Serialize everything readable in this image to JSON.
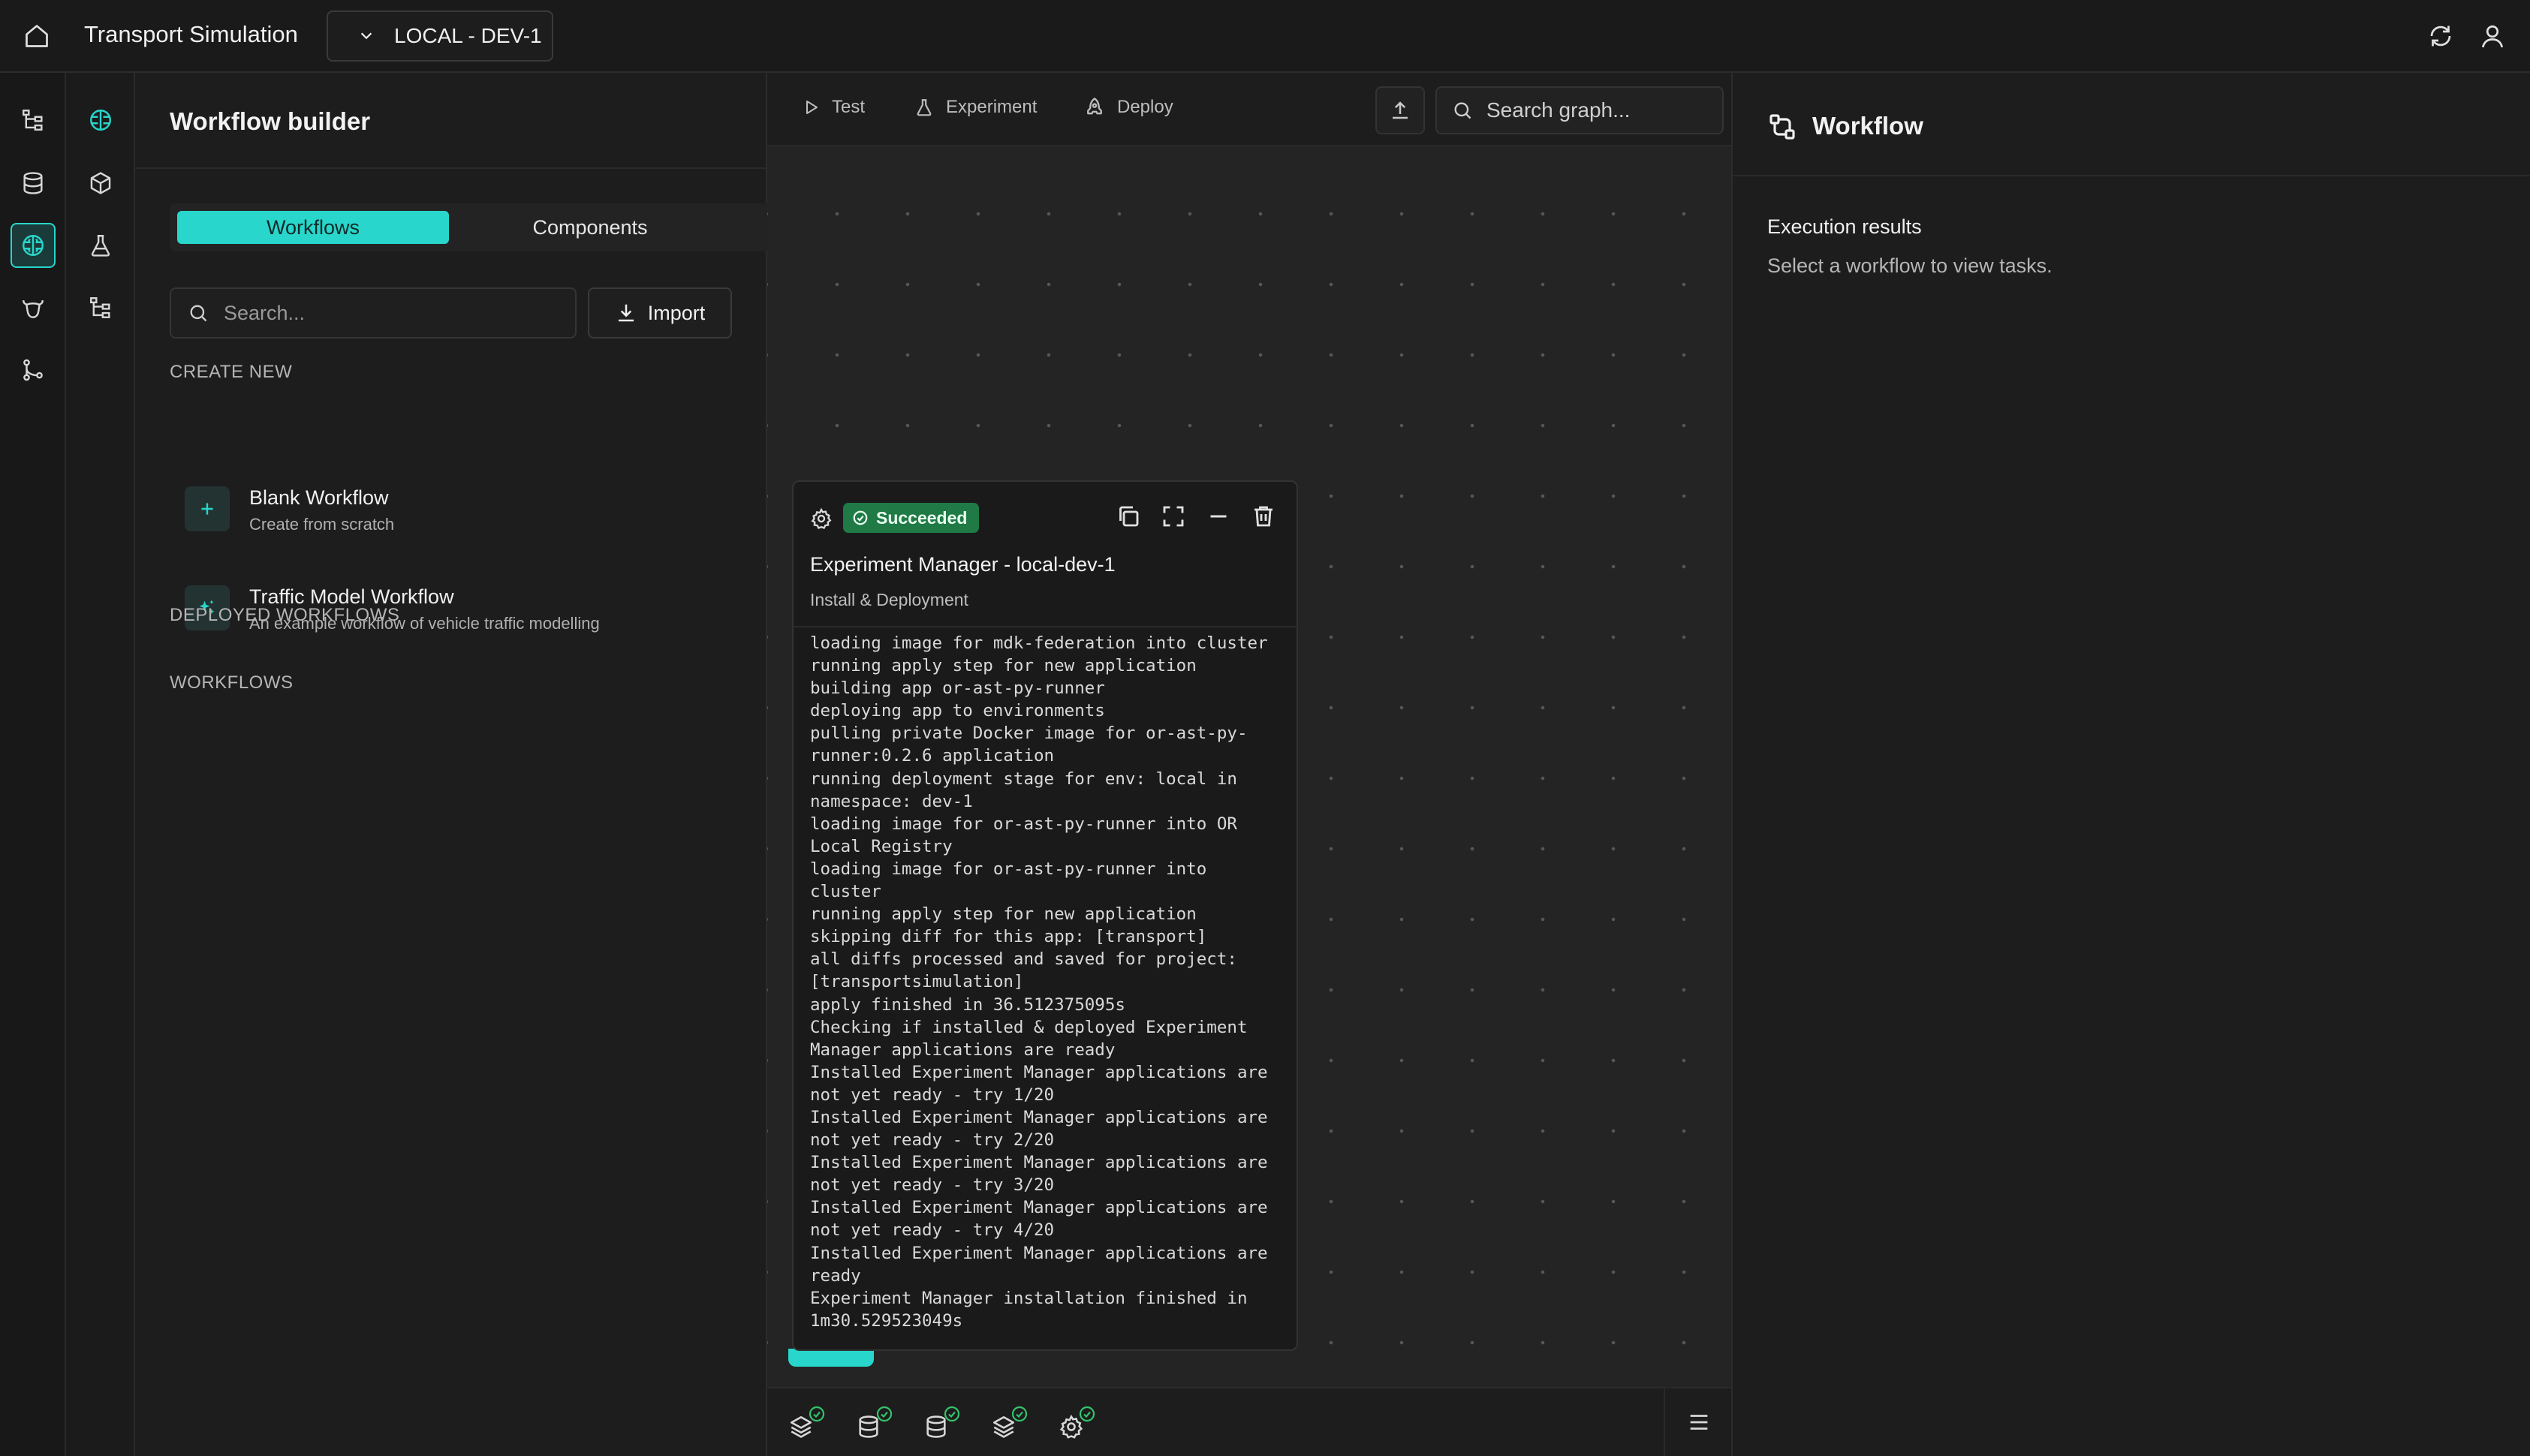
{
  "app": {
    "title": "Transport Simulation",
    "environment": "LOCAL - DEV-1"
  },
  "colors": {
    "accent": "#28d6cb",
    "success": "#1f7a45",
    "success_check": "#33c46b"
  },
  "left_panel": {
    "title": "Workflow builder",
    "tabs": [
      {
        "label": "Workflows",
        "active": true
      },
      {
        "label": "Components",
        "active": false
      }
    ],
    "search_placeholder": "Search...",
    "import_label": "Import",
    "create_new_label": "CREATE NEW",
    "create_items": [
      {
        "title": "Blank Workflow",
        "subtitle": "Create from scratch",
        "icon": "plus-icon"
      },
      {
        "title": "Traffic Model Workflow",
        "subtitle": "An example workflow of vehicle traffic modelling",
        "icon": "sparkle-icon"
      }
    ],
    "deployed_label": "DEPLOYED WORKFLOWS",
    "workflows_label": "WORKFLOWS"
  },
  "canvas": {
    "toolbar": {
      "test_label": "Test",
      "experiment_label": "Experiment",
      "deploy_label": "Deploy",
      "search_placeholder": "Search graph..."
    },
    "card": {
      "status": "Succeeded",
      "title": "Experiment Manager - local-dev-1",
      "subtitle": "Install & Deployment",
      "log_lines": [
        "loading image for mdk-federation into cluster",
        "running apply step for new application",
        "building app or-ast-py-runner",
        "deploying app to environments",
        "pulling private Docker image for or-ast-py-",
        "runner:0.2.6 application",
        "running deployment stage for env: local in",
        "namespace: dev-1",
        "loading image for or-ast-py-runner into OR",
        "Local Registry",
        "loading image for or-ast-py-runner into",
        "cluster",
        "running apply step for new application",
        "skipping diff for this app: [transport]",
        "all diffs processed and saved for project:",
        "[transportsimulation]",
        "apply finished in 36.512375095s",
        "Checking if installed & deployed Experiment",
        "Manager applications are ready",
        "Installed Experiment Manager applications are",
        "not yet ready - try 1/20",
        "Installed Experiment Manager applications are",
        "not yet ready - try 2/20",
        "Installed Experiment Manager applications are",
        "not yet ready - try 3/20",
        "Installed Experiment Manager applications are",
        "not yet ready - try 4/20",
        "Installed Experiment Manager applications are",
        "ready",
        "Experiment Manager installation finished in",
        "1m30.529523049s"
      ]
    },
    "status_icons": [
      "layers-icon",
      "database-icon",
      "database-icon",
      "layers-icon",
      "gear-icon"
    ]
  },
  "right_panel": {
    "title": "Workflow",
    "execution_label": "Execution results",
    "hint": "Select a workflow to view tasks."
  }
}
